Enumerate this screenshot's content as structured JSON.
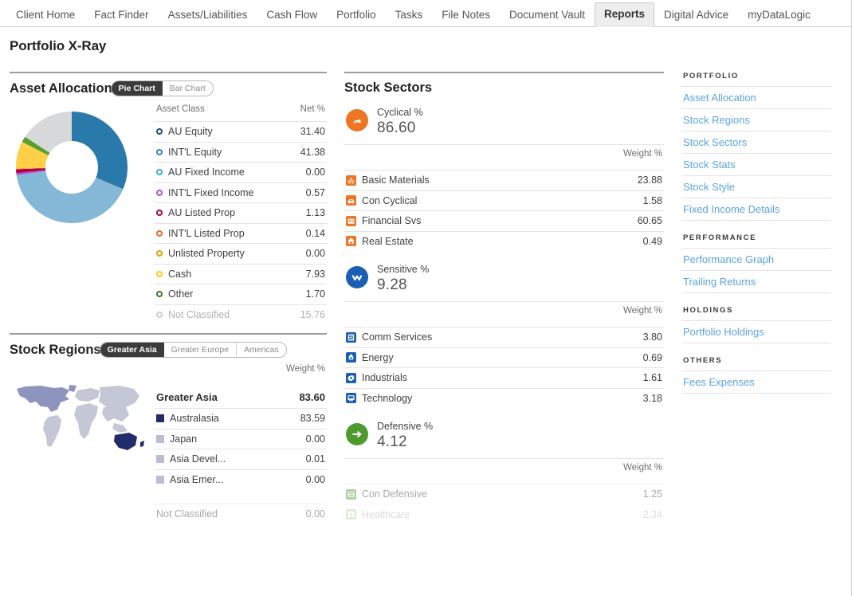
{
  "topnav": {
    "tabs": [
      {
        "label": "Client Home",
        "active": false
      },
      {
        "label": "Fact Finder",
        "active": false
      },
      {
        "label": "Assets/Liabilities",
        "active": false
      },
      {
        "label": "Cash Flow",
        "active": false
      },
      {
        "label": "Portfolio",
        "active": false
      },
      {
        "label": "Tasks",
        "active": false
      },
      {
        "label": "File Notes",
        "active": false
      },
      {
        "label": "Document Vault",
        "active": false
      },
      {
        "label": "Reports",
        "active": true
      },
      {
        "label": "Digital Advice",
        "active": false
      },
      {
        "label": "myDataLogic",
        "active": false
      }
    ]
  },
  "page": {
    "title": "Portfolio X-Ray"
  },
  "asset_allocation": {
    "title": "Asset Allocation",
    "toggle": [
      {
        "label": "Pie Chart",
        "active": true
      },
      {
        "label": "Bar Chart",
        "active": false
      }
    ],
    "columns": [
      "Asset Class",
      "Net %"
    ],
    "rows": [
      {
        "label": "AU Equity",
        "value": "31.40",
        "color": "#1f4e79"
      },
      {
        "label": "INT'L Equity",
        "value": "41.38",
        "color": "#3a7fb8"
      },
      {
        "label": "AU Fixed Income",
        "value": "0.00",
        "color": "#3aa9e0"
      },
      {
        "label": "INT'L Fixed Income",
        "value": "0.57",
        "color": "#a855d6"
      },
      {
        "label": "AU Listed Prop",
        "value": "1.13",
        "color": "#b3003c"
      },
      {
        "label": "INT'L Listed Prop",
        "value": "0.14",
        "color": "#ee6b2a"
      },
      {
        "label": "Unlisted Property",
        "value": "0.00",
        "color": "#e0a500"
      },
      {
        "label": "Cash",
        "value": "7.93",
        "color": "#ffc820"
      },
      {
        "label": "Other",
        "value": "1.70",
        "color": "#3d7a1e"
      },
      {
        "label": "Not Classified",
        "value": "15.76",
        "color": "#cccccc",
        "muted": true
      }
    ]
  },
  "chart_data": [
    {
      "type": "pie",
      "title": "Asset Allocation",
      "labels": [
        "AU Equity",
        "INT'L Equity",
        "AU Fixed Income",
        "INT'L Fixed Income",
        "AU Listed Prop",
        "INT'L Listed Prop",
        "Unlisted Property",
        "Cash",
        "Other",
        "Not Classified"
      ],
      "values": [
        31.4,
        41.38,
        0.0,
        0.57,
        1.13,
        0.14,
        0.0,
        7.93,
        1.7,
        15.76
      ],
      "colors": [
        "#2a79ab",
        "#85b8d6",
        "#3aa9e0",
        "#a855d6",
        "#b3003c",
        "#ee6b2a",
        "#e0a500",
        "#fdd047",
        "#5a9e2f",
        "#d6d8da"
      ],
      "ylabel": "Net %",
      "legend": "right"
    },
    {
      "type": "table",
      "title": "Stock Regions",
      "categories": [
        "Greater Asia",
        "Australasia",
        "Japan",
        "Asia Devel...",
        "Asia Emer...",
        "Not Classified"
      ],
      "values": [
        83.6,
        83.59,
        0.0,
        0.01,
        0.0,
        0.0
      ],
      "ylabel": "Weight %"
    },
    {
      "type": "table",
      "title": "Stock Sectors",
      "series": [
        {
          "name": "Cyclical %",
          "total": 86.6,
          "categories": [
            "Basic Materials",
            "Con Cyclical",
            "Financial Svs",
            "Real Estate"
          ],
          "values": [
            23.88,
            1.58,
            60.65,
            0.49
          ]
        },
        {
          "name": "Sensitive %",
          "total": 9.28,
          "categories": [
            "Comm Services",
            "Energy",
            "Industrials",
            "Technology"
          ],
          "values": [
            3.8,
            0.69,
            1.61,
            3.18
          ]
        },
        {
          "name": "Defensive %",
          "total": 4.12,
          "categories": [
            "Con Defensive",
            "Healthcare"
          ],
          "values": [
            1.25,
            2.34
          ]
        }
      ],
      "ylabel": "Weight %"
    }
  ],
  "stock_regions": {
    "title": "Stock Regions",
    "toggle": [
      {
        "label": "Greater Asia",
        "active": true
      },
      {
        "label": "Greater Europe",
        "active": false
      },
      {
        "label": "Americas",
        "active": false
      }
    ],
    "column_header": "Weight %",
    "total": {
      "label": "Greater Asia",
      "value": "83.60"
    },
    "rows": [
      {
        "label": "Australasia",
        "value": "83.59",
        "dark": true
      },
      {
        "label": "Japan",
        "value": "0.00",
        "dark": false
      },
      {
        "label": "Asia Devel...",
        "value": "0.01",
        "dark": false
      },
      {
        "label": "Asia Emer...",
        "value": "0.00",
        "dark": false
      }
    ],
    "footer": {
      "label": "Not Classified",
      "value": "0.00"
    }
  },
  "stock_sectors": {
    "title": "Stock Sectors",
    "column_header": "Weight %",
    "groups": [
      {
        "name": "Cyclical %",
        "value": "86.60",
        "color": "#ee7623",
        "icon": "wave-icon",
        "rows": [
          {
            "label": "Basic Materials",
            "value": "23.88",
            "icon": "basic-materials-icon"
          },
          {
            "label": "Con Cyclical",
            "value": "1.58",
            "icon": "con-cyclical-icon"
          },
          {
            "label": "Financial Svs",
            "value": "60.65",
            "icon": "financial-svs-icon"
          },
          {
            "label": "Real Estate",
            "value": "0.49",
            "icon": "real-estate-icon"
          }
        ]
      },
      {
        "name": "Sensitive %",
        "value": "9.28",
        "color": "#1a5fb4",
        "icon": "zigzag-icon",
        "rows": [
          {
            "label": "Comm Services",
            "value": "3.80",
            "icon": "comm-services-icon"
          },
          {
            "label": "Energy",
            "value": "0.69",
            "icon": "energy-icon"
          },
          {
            "label": "Industrials",
            "value": "1.61",
            "icon": "industrials-icon"
          },
          {
            "label": "Technology",
            "value": "3.18",
            "icon": "technology-icon"
          }
        ]
      },
      {
        "name": "Defensive %",
        "value": "4.12",
        "color": "#4f9a2f",
        "icon": "arrow-right-icon",
        "rows": [
          {
            "label": "Con Defensive",
            "value": "1.25",
            "icon": "con-defensive-icon"
          },
          {
            "label": "Healthcare",
            "value": "2.34",
            "icon": "healthcare-icon"
          }
        ]
      }
    ]
  },
  "sidebar": {
    "groups": [
      {
        "heading": "PORTFOLIO",
        "links": [
          "Asset Allocation",
          "Stock Regions",
          "Stock Sectors",
          "Stock Stats",
          "Stock Style",
          "Fixed Income Details"
        ]
      },
      {
        "heading": "PERFORMANCE",
        "links": [
          "Performance Graph",
          "Trailing Returns"
        ]
      },
      {
        "heading": "HOLDINGS",
        "links": [
          "Portfolio Holdings"
        ]
      },
      {
        "heading": "OTHERS",
        "links": [
          "Fees Expenses"
        ]
      }
    ]
  }
}
